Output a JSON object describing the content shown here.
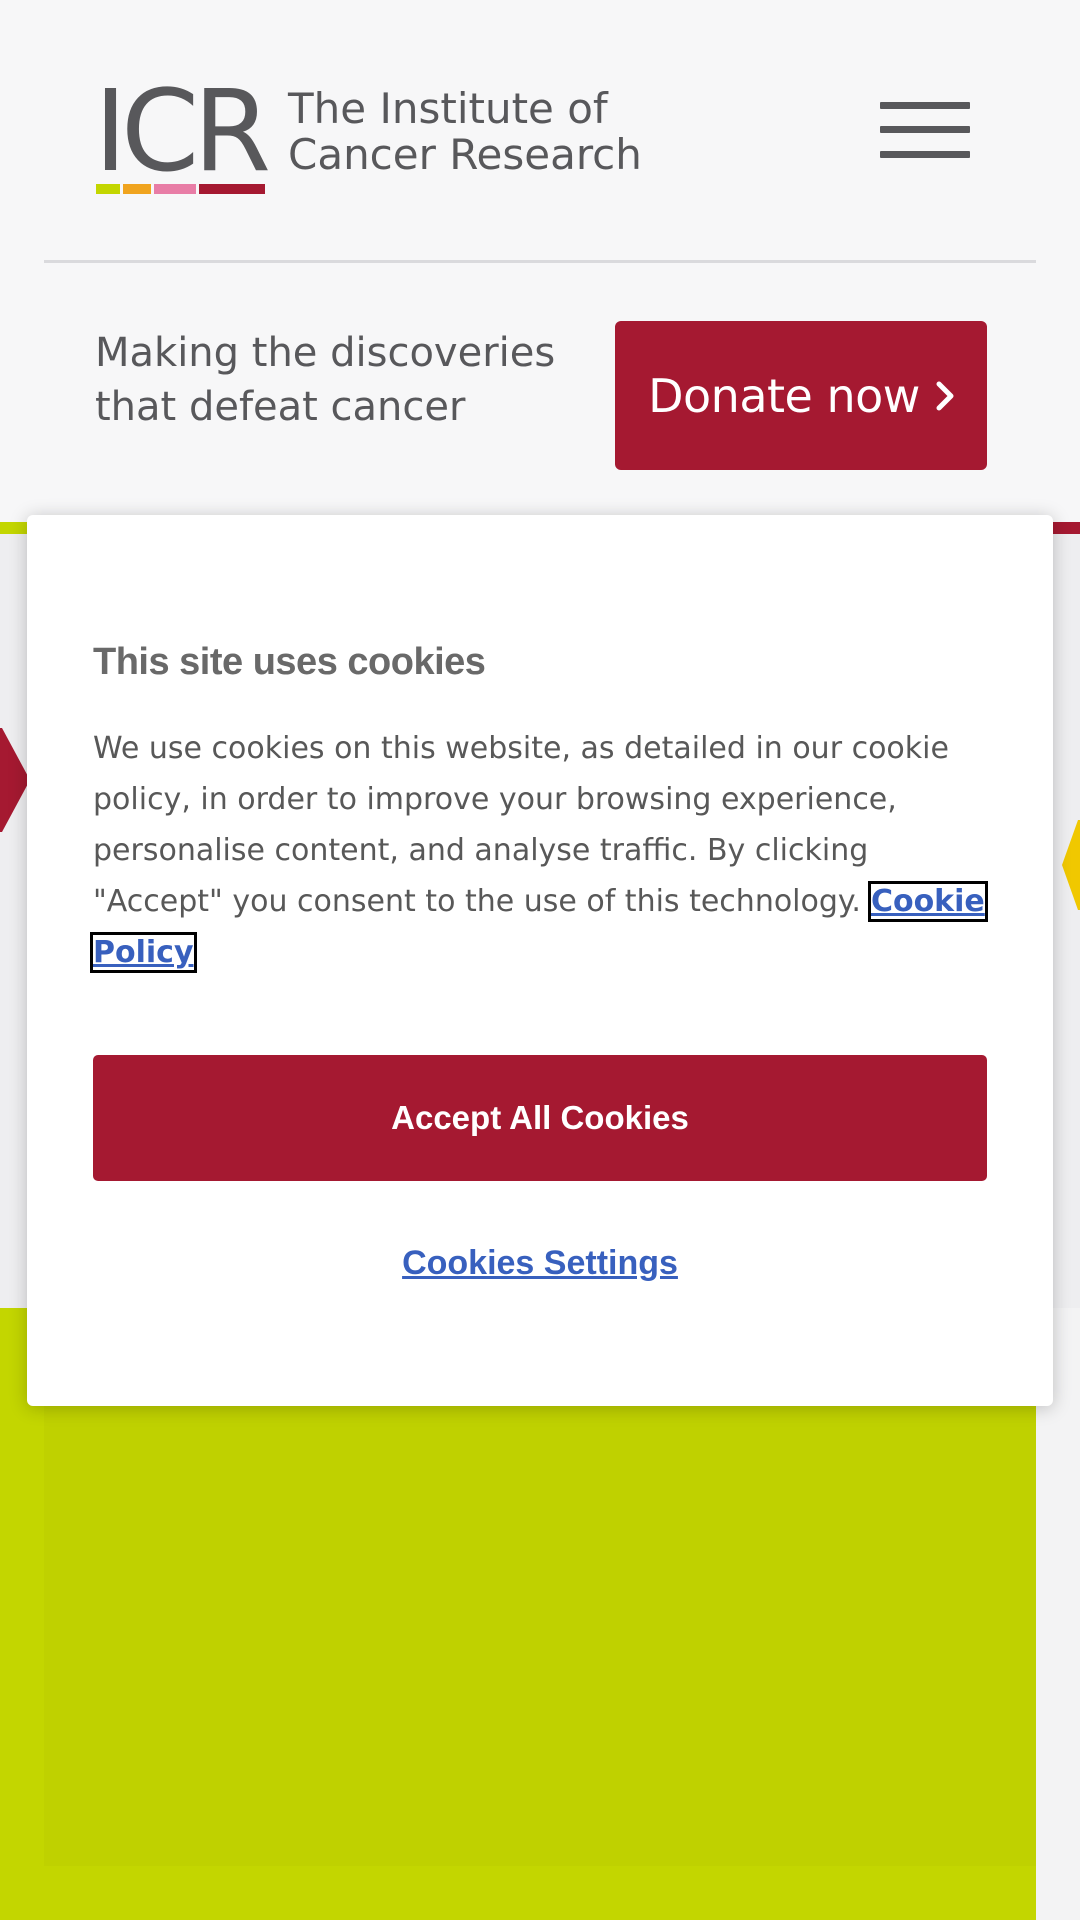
{
  "header": {
    "logo_mark": "ICR",
    "logo_line1": "The Institute of",
    "logo_line2": "Cancer Research",
    "logo_bar_colors": [
      "#c3d600",
      "#f0a41f",
      "#e87da6",
      "#a51931"
    ],
    "menu_icon": "hamburger-menu-icon"
  },
  "hero": {
    "tagline_line1": "Making the discoveries",
    "tagline_line2": "that defeat cancer",
    "donate_label": "Donate now",
    "donate_icon": "chevron-right-icon"
  },
  "cookie_banner": {
    "title": "This site uses cookies",
    "body": "We use cookies on this website, as detailed in our cookie policy, in order to improve your browsing experience, personalise content, and analyse traffic. By clicking \"Accept\" you consent to the use of this technology.",
    "policy_link": "Cookie Policy",
    "accept_label": "Accept All Cookies",
    "settings_label": "Cookies Settings"
  },
  "colors": {
    "brand_red": "#a51931",
    "brand_lime": "#c3d600",
    "text_grey": "#58585b",
    "link_blue": "#3860be"
  }
}
